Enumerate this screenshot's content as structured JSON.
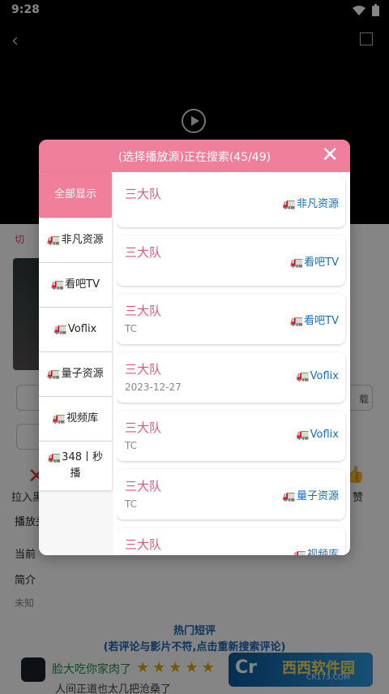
{
  "status_bar": {
    "time": "9:28"
  },
  "background": {
    "switch_text": "切",
    "right_chip": "载",
    "left_action_label": "拉入黑",
    "right_action_label": "赞",
    "play_source_label": "播放头",
    "current_label": "当前",
    "intro_label": "简介",
    "intro_value": "未知",
    "hot_title": "热门短评",
    "hot_subtitle": "(若评论与影片不符,点击重新搜索评论)",
    "comment": {
      "user": "脸大吃你家肉了",
      "text": "人间正道也太几把沧桑了",
      "stars": [
        "★",
        "★",
        "★",
        "★",
        "★"
      ]
    },
    "watermark": {
      "logo": "Cr",
      "brand": "西西软件园",
      "site": "CR173.COM"
    }
  },
  "modal": {
    "title": "(选择播放源)正在搜索(45/49)",
    "close": "✕",
    "sidebar": [
      {
        "label": "全部显示",
        "truck": ""
      },
      {
        "label": "非凡资源",
        "truck": "🚛"
      },
      {
        "label": "看吧TV",
        "truck": "🚛"
      },
      {
        "label": "Voflix",
        "truck": "🚛"
      },
      {
        "label": "量子资源",
        "truck": "🚛"
      },
      {
        "label": "视频库",
        "truck": "🚛"
      },
      {
        "label": "348丨秒播",
        "truck": "🚛"
      }
    ],
    "results": [
      {
        "title": "三大队",
        "sub": "",
        "source": "非凡资源",
        "truck": "🚛"
      },
      {
        "title": "三大队",
        "sub": "",
        "source": "看吧TV",
        "truck": "🚛"
      },
      {
        "title": "三大队",
        "sub": "TC",
        "source": "看吧TV",
        "truck": "🚛"
      },
      {
        "title": "三大队",
        "sub": "2023-12-27",
        "source": "Voflix",
        "truck": "🚛"
      },
      {
        "title": "三大队",
        "sub": "TC",
        "source": "Voflix",
        "truck": "🚛"
      },
      {
        "title": "三大队",
        "sub": "TC",
        "source": "量子资源",
        "truck": "🚛"
      },
      {
        "title": "三大队",
        "sub": "",
        "source": "视频库",
        "truck": "🚛"
      }
    ]
  }
}
